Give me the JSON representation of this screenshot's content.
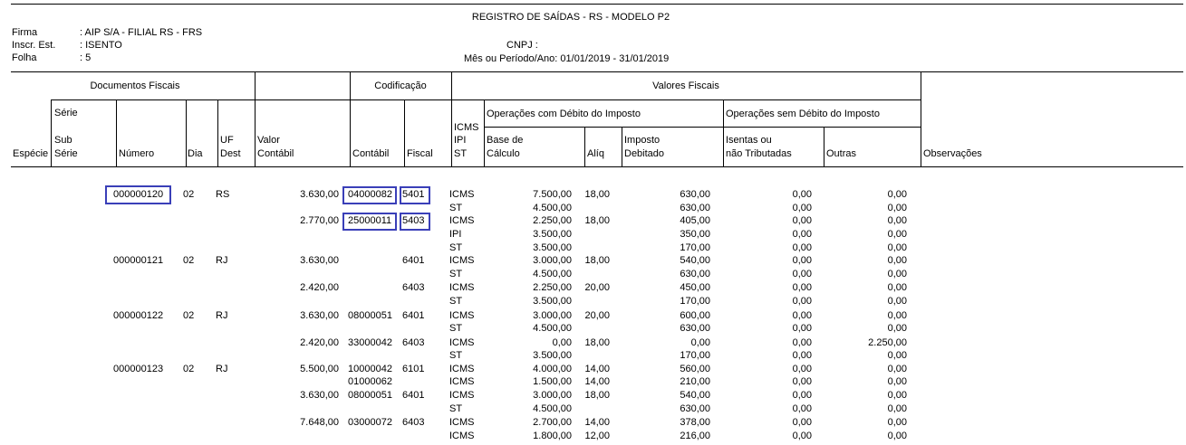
{
  "report": {
    "title": "REGISTRO DE SAÍDAS - RS - MODELO P2",
    "firma_label": "Firma",
    "firma_value": ": AIP S/A -   FILIAL RS - FRS",
    "inscr_label": "Inscr. Est.",
    "inscr_value": ": ISENTO",
    "folha_label": "Folha",
    "folha_value": ": 5",
    "cnpj_label": "CNPJ :",
    "periodo": "Mês ou Período/Ano: 01/01/2019 - 31/01/2019"
  },
  "headers": {
    "documentos_fiscais": "Documentos Fiscais",
    "codificacao": "Codificação",
    "valores_fiscais": "Valores Fiscais",
    "serie": "Série",
    "especie": "Espécie",
    "sub": "Sub",
    "sub_serie": "Série",
    "numero": "Número",
    "dia": "Dia",
    "uf": "UF",
    "dest": "Dest",
    "valor": "Valor",
    "contabil_valor": "Contábil",
    "contabil": "Contábil",
    "fiscal": "Fiscal",
    "icms": "ICMS",
    "ipi": "IPI",
    "st": "ST",
    "op_com_debito": "Operações com Débito do Imposto",
    "op_sem_debito": "Operações sem Débito do Imposto",
    "base": "Base de",
    "calculo": "Cálculo",
    "aliq": "Alíq",
    "imposto": "Imposto",
    "debitado": "Debitado",
    "isentas": "Isentas ou",
    "nao_tributadas": "não Tributadas",
    "outras": "Outras",
    "observacoes": "Observações"
  },
  "rows": [
    {
      "numero": "000000120",
      "dia": "02",
      "uf": "RS",
      "valor": "3.630,00",
      "contabil": "04000082",
      "fiscal": "5401",
      "tipo": "ICMS",
      "base": "7.500,00",
      "aliq": "18,00",
      "imposto": "630,00",
      "isentas": "0,00",
      "outras": "0,00"
    },
    {
      "numero": "",
      "dia": "",
      "uf": "",
      "valor": "",
      "contabil": "",
      "fiscal": "",
      "tipo": "ST",
      "base": "4.500,00",
      "aliq": "",
      "imposto": "630,00",
      "isentas": "0,00",
      "outras": "0,00"
    },
    {
      "numero": "",
      "dia": "",
      "uf": "",
      "valor": "2.770,00",
      "contabil": "25000011",
      "fiscal": "5403",
      "tipo": "ICMS",
      "base": "2.250,00",
      "aliq": "18,00",
      "imposto": "405,00",
      "isentas": "0,00",
      "outras": "0,00"
    },
    {
      "numero": "",
      "dia": "",
      "uf": "",
      "valor": "",
      "contabil": "",
      "fiscal": "",
      "tipo": "IPI",
      "base": "3.500,00",
      "aliq": "",
      "imposto": "350,00",
      "isentas": "0,00",
      "outras": "0,00"
    },
    {
      "numero": "",
      "dia": "",
      "uf": "",
      "valor": "",
      "contabil": "",
      "fiscal": "",
      "tipo": "ST",
      "base": "3.500,00",
      "aliq": "",
      "imposto": "170,00",
      "isentas": "0,00",
      "outras": "0,00"
    },
    {
      "numero": "000000121",
      "dia": "02",
      "uf": "RJ",
      "valor": "3.630,00",
      "contabil": "",
      "fiscal": "6401",
      "tipo": "ICMS",
      "base": "3.000,00",
      "aliq": "18,00",
      "imposto": "540,00",
      "isentas": "0,00",
      "outras": "0,00"
    },
    {
      "numero": "",
      "dia": "",
      "uf": "",
      "valor": "",
      "contabil": "",
      "fiscal": "",
      "tipo": "ST",
      "base": "4.500,00",
      "aliq": "",
      "imposto": "630,00",
      "isentas": "0,00",
      "outras": "0,00"
    },
    {
      "numero": "",
      "dia": "",
      "uf": "",
      "valor": "2.420,00",
      "contabil": "",
      "fiscal": "6403",
      "tipo": "ICMS",
      "base": "2.250,00",
      "aliq": "20,00",
      "imposto": "450,00",
      "isentas": "0,00",
      "outras": "0,00"
    },
    {
      "numero": "",
      "dia": "",
      "uf": "",
      "valor": "",
      "contabil": "",
      "fiscal": "",
      "tipo": "ST",
      "base": "3.500,00",
      "aliq": "",
      "imposto": "170,00",
      "isentas": "0,00",
      "outras": "0,00"
    },
    {
      "numero": "000000122",
      "dia": "02",
      "uf": "RJ",
      "valor": "3.630,00",
      "contabil": "08000051",
      "fiscal": "6401",
      "tipo": "ICMS",
      "base": "3.000,00",
      "aliq": "20,00",
      "imposto": "600,00",
      "isentas": "0,00",
      "outras": "0,00"
    },
    {
      "numero": "",
      "dia": "",
      "uf": "",
      "valor": "",
      "contabil": "",
      "fiscal": "",
      "tipo": "ST",
      "base": "4.500,00",
      "aliq": "",
      "imposto": "630,00",
      "isentas": "0,00",
      "outras": "0,00"
    },
    {
      "numero": "",
      "dia": "",
      "uf": "",
      "valor": "2.420,00",
      "contabil": "33000042",
      "fiscal": "6403",
      "tipo": "ICMS",
      "base": "0,00",
      "aliq": "18,00",
      "imposto": "0,00",
      "isentas": "0,00",
      "outras": "2.250,00"
    },
    {
      "numero": "",
      "dia": "",
      "uf": "",
      "valor": "",
      "contabil": "",
      "fiscal": "",
      "tipo": "ST",
      "base": "3.500,00",
      "aliq": "",
      "imposto": "170,00",
      "isentas": "0,00",
      "outras": "0,00"
    },
    {
      "numero": "000000123",
      "dia": "02",
      "uf": "RJ",
      "valor": "5.500,00",
      "contabil": "10000042",
      "fiscal": "6101",
      "tipo": "ICMS",
      "base": "4.000,00",
      "aliq": "14,00",
      "imposto": "560,00",
      "isentas": "0,00",
      "outras": "0,00"
    },
    {
      "numero": "",
      "dia": "",
      "uf": "",
      "valor": "",
      "contabil": "01000062",
      "fiscal": "",
      "tipo": "ICMS",
      "base": "1.500,00",
      "aliq": "14,00",
      "imposto": "210,00",
      "isentas": "0,00",
      "outras": "0,00"
    },
    {
      "numero": "",
      "dia": "",
      "uf": "",
      "valor": "3.630,00",
      "contabil": "08000051",
      "fiscal": "6401",
      "tipo": "ICMS",
      "base": "3.000,00",
      "aliq": "18,00",
      "imposto": "540,00",
      "isentas": "0,00",
      "outras": "0,00"
    },
    {
      "numero": "",
      "dia": "",
      "uf": "",
      "valor": "",
      "contabil": "",
      "fiscal": "",
      "tipo": "ST",
      "base": "4.500,00",
      "aliq": "",
      "imposto": "630,00",
      "isentas": "0,00",
      "outras": "0,00"
    },
    {
      "numero": "",
      "dia": "",
      "uf": "",
      "valor": "7.648,00",
      "contabil": "03000072",
      "fiscal": "6403",
      "tipo": "ICMS",
      "base": "2.700,00",
      "aliq": "14,00",
      "imposto": "378,00",
      "isentas": "0,00",
      "outras": "0,00"
    },
    {
      "numero": "",
      "dia": "",
      "uf": "",
      "valor": "",
      "contabil": "",
      "fiscal": "",
      "tipo": "ICMS",
      "base": "1.800,00",
      "aliq": "12,00",
      "imposto": "216,00",
      "isentas": "0,00",
      "outras": "0,00"
    }
  ]
}
